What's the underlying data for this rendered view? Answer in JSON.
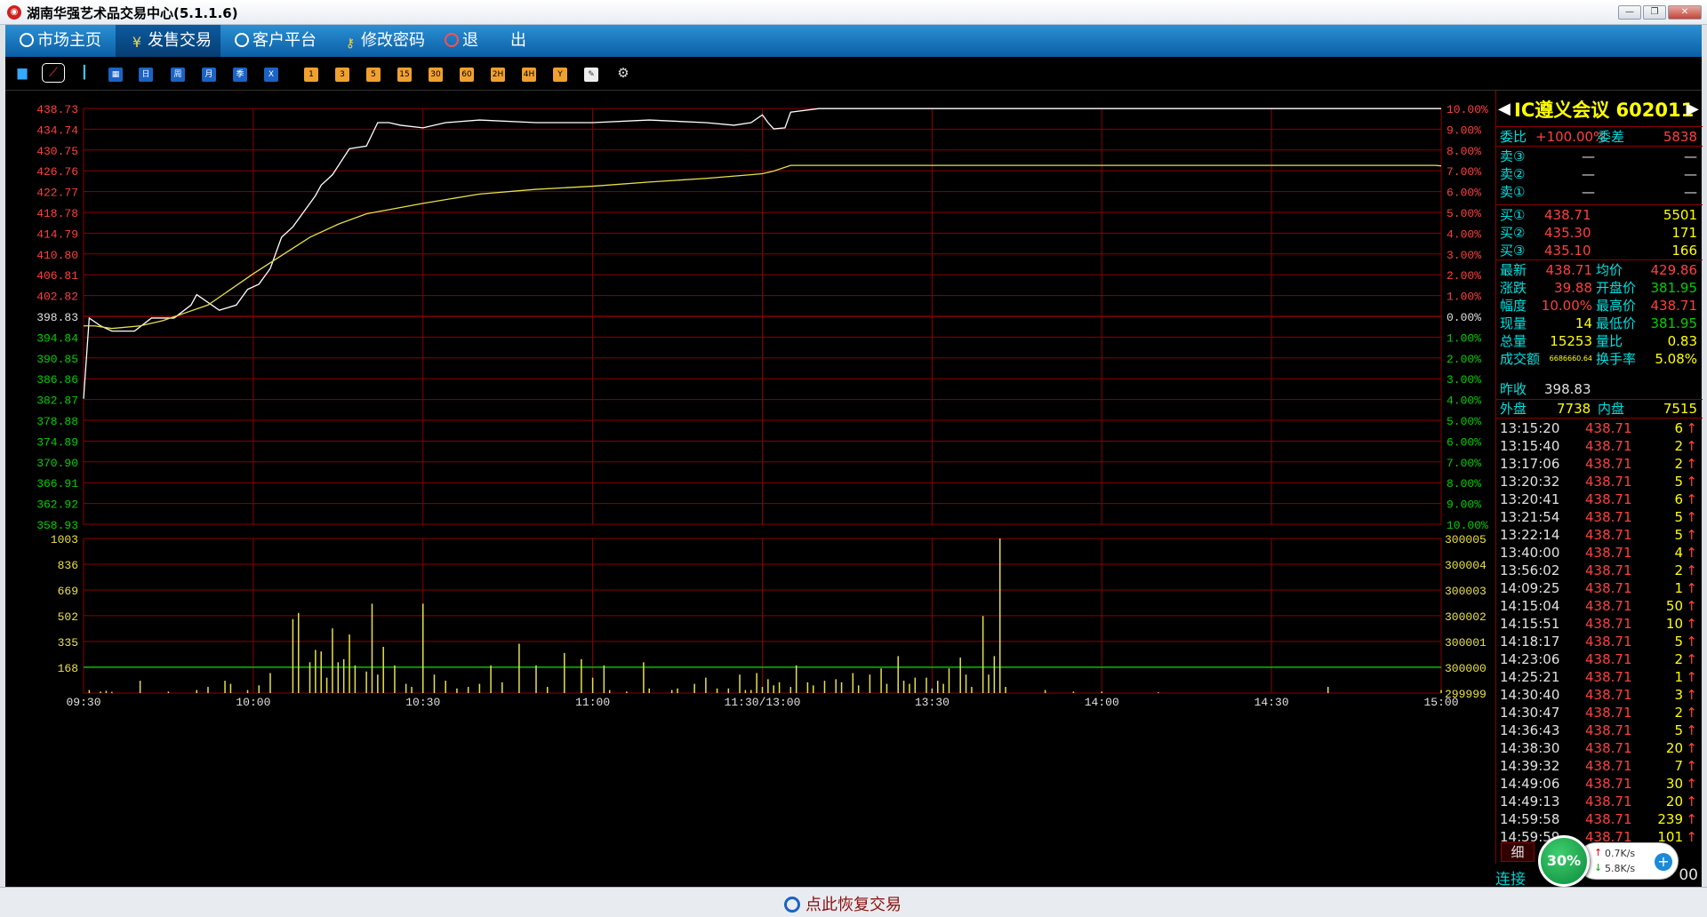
{
  "window": {
    "title": "湖南华强艺术品交易中心(5.1.1.6)"
  },
  "menu": {
    "items": [
      {
        "label": "市场主页"
      },
      {
        "label": "发售交易"
      },
      {
        "label": "客户平台"
      },
      {
        "label": "修改密码"
      },
      {
        "label": "退　　出"
      }
    ]
  },
  "toolbar": {
    "period_buttons": [
      "日",
      "周",
      "月",
      "季",
      "X"
    ],
    "minute_buttons": [
      "1",
      "3",
      "5",
      "15",
      "30",
      "60",
      "2H",
      "4H",
      "Y"
    ]
  },
  "chart_data": [
    {
      "type": "line",
      "title": "",
      "price_axis": [
        "438.73",
        "434.74",
        "430.75",
        "426.76",
        "422.77",
        "418.78",
        "414.79",
        "410.80",
        "406.81",
        "402.82",
        "398.83",
        "394.84",
        "390.85",
        "386.86",
        "382.87",
        "378.88",
        "374.89",
        "370.90",
        "366.91",
        "362.92",
        "358.93"
      ],
      "pct_axis": [
        "10.00%",
        "9.00%",
        "8.00%",
        "7.00%",
        "6.00%",
        "5.00%",
        "4.00%",
        "3.00%",
        "2.00%",
        "1.00%",
        "0.00%",
        "1.00%",
        "2.00%",
        "3.00%",
        "4.00%",
        "5.00%",
        "6.00%",
        "7.00%",
        "8.00%",
        "9.00%",
        "10.00%"
      ],
      "ylim": [
        358.93,
        438.73
      ],
      "x_ticks": [
        "09:30",
        "10:00",
        "10:30",
        "11:00",
        "11:30/13:00",
        "13:30",
        "14:00",
        "14:30",
        "15:00"
      ],
      "series": [
        {
          "name": "",
          "color": "#ffffff",
          "x": [
            0,
            1,
            3,
            5,
            9,
            12,
            16,
            19,
            20,
            24,
            27,
            29,
            31,
            33,
            35,
            37,
            39,
            41,
            42,
            44,
            47,
            50,
            52,
            54,
            56,
            60,
            64,
            70,
            80,
            90,
            100,
            110,
            115,
            118,
            120,
            121,
            122,
            124,
            125,
            130,
            135,
            140,
            145,
            150,
            160,
            170,
            180,
            190,
            200,
            210,
            220,
            230,
            235,
            239,
            240
          ],
          "y": [
            383.0,
            398.5,
            397.0,
            396.0,
            396.0,
            398.5,
            398.5,
            401.0,
            403.0,
            400.0,
            401.0,
            404.0,
            405.0,
            408.0,
            414.0,
            416.0,
            419.0,
            422.0,
            424.0,
            426.0,
            431.0,
            431.5,
            436.0,
            436.0,
            435.5,
            435.0,
            436.0,
            436.5,
            436.0,
            436.0,
            436.5,
            436.0,
            435.5,
            436.0,
            437.5,
            436.0,
            434.8,
            435.0,
            438.0,
            438.7,
            438.7,
            438.7,
            438.7,
            438.7,
            438.7,
            438.7,
            438.7,
            438.7,
            438.7,
            438.7,
            438.7,
            438.7,
            438.7,
            438.7,
            438.7
          ]
        },
        {
          "name": "",
          "color": "#e8e048",
          "x": [
            0,
            2,
            5,
            10,
            14,
            18,
            22,
            26,
            30,
            35,
            40,
            45,
            50,
            55,
            60,
            70,
            80,
            90,
            100,
            110,
            118,
            120,
            122,
            125,
            130,
            150,
            170,
            190,
            210,
            230,
            239,
            240
          ],
          "y": [
            397.0,
            397.0,
            396.5,
            397.0,
            398.0,
            399.5,
            401.0,
            404.0,
            407.0,
            410.5,
            414.0,
            416.5,
            418.5,
            419.5,
            420.5,
            422.3,
            423.2,
            423.8,
            424.6,
            425.3,
            426.0,
            426.2,
            426.7,
            427.8,
            427.8,
            427.8,
            427.8,
            427.8,
            427.8,
            427.8,
            427.8,
            427.7
          ]
        }
      ]
    },
    {
      "type": "bar",
      "title": "",
      "volume_axis_left": [
        "1003",
        "836",
        "669",
        "502",
        "335",
        "168"
      ],
      "volume_axis_right": [
        "300005",
        "300004",
        "300003",
        "300002",
        "300001",
        "300000",
        "299999"
      ],
      "ylim": [
        0,
        1003
      ],
      "reference_line": 168,
      "x": [
        1,
        3,
        4,
        5,
        10,
        15,
        20,
        22,
        25,
        26,
        29,
        31,
        33,
        37,
        38,
        40,
        41,
        42,
        43,
        44,
        45,
        46,
        47,
        48,
        50,
        51,
        52,
        53,
        55,
        57,
        58,
        60,
        62,
        64,
        66,
        68,
        70,
        72,
        74,
        77,
        80,
        82,
        85,
        88,
        90,
        92,
        93,
        96,
        99,
        100,
        104,
        105,
        108,
        110,
        112,
        114,
        116,
        117,
        118,
        119,
        120,
        121,
        122,
        123,
        125,
        126,
        128,
        129,
        131,
        133,
        134,
        136,
        137,
        139,
        141,
        142,
        144,
        145,
        146,
        147,
        149,
        150,
        151,
        152,
        153,
        155,
        156,
        157,
        159,
        160,
        161,
        162,
        163,
        170,
        175,
        180,
        190,
        220,
        240
      ],
      "y": [
        20,
        10,
        15,
        8,
        80,
        10,
        20,
        40,
        80,
        60,
        20,
        50,
        130,
        480,
        520,
        200,
        280,
        270,
        100,
        420,
        200,
        220,
        380,
        180,
        140,
        580,
        120,
        300,
        180,
        60,
        40,
        580,
        120,
        80,
        30,
        40,
        60,
        180,
        70,
        320,
        180,
        40,
        260,
        220,
        100,
        180,
        20,
        10,
        200,
        30,
        20,
        30,
        60,
        100,
        30,
        30,
        120,
        20,
        20,
        130,
        40,
        90,
        50,
        70,
        40,
        180,
        70,
        50,
        80,
        90,
        70,
        130,
        50,
        120,
        160,
        60,
        240,
        80,
        60,
        100,
        100,
        30,
        80,
        60,
        160,
        230,
        120,
        40,
        500,
        120,
        240,
        1003,
        40,
        20,
        10,
        10,
        5,
        40,
        20
      ]
    }
  ],
  "quote": {
    "name": "IC遵义会议",
    "code": "602011",
    "webi_label": "委比",
    "webi_value": "+100.00%",
    "weicha_label": "委差",
    "weicha_value": "5838",
    "asks": [
      {
        "label": "卖③",
        "price": "—",
        "vol": "—"
      },
      {
        "label": "卖②",
        "price": "—",
        "vol": "—"
      },
      {
        "label": "卖①",
        "price": "—",
        "vol": "—"
      }
    ],
    "bids": [
      {
        "label": "买①",
        "price": "438.71",
        "vol": "5501"
      },
      {
        "label": "买②",
        "price": "435.30",
        "vol": "171"
      },
      {
        "label": "买③",
        "price": "435.10",
        "vol": "166"
      }
    ],
    "stats": [
      {
        "l1": "最新",
        "v1": "438.71",
        "l2": "均价",
        "v2": "429.86",
        "c1": "red",
        "c2": "red"
      },
      {
        "l1": "涨跌",
        "v1": "39.88",
        "l2": "开盘价",
        "v2": "381.95",
        "c1": "red",
        "c2": "grn"
      },
      {
        "l1": "幅度",
        "v1": "10.00%",
        "l2": "最高价",
        "v2": "438.71",
        "c1": "red",
        "c2": "red"
      },
      {
        "l1": "现量",
        "v1": "14",
        "l2": "最低价",
        "v2": "381.95",
        "c1": "yel",
        "c2": "grn"
      },
      {
        "l1": "总量",
        "v1": "15253",
        "l2": "量比",
        "v2": "0.83",
        "c1": "yel",
        "c2": "yel"
      },
      {
        "l1": "成交额",
        "v1": "6686660.64",
        "l2": "换手率",
        "v2": "5.08%",
        "c1": "yel",
        "c2": "yel"
      }
    ],
    "prev_close_label": "昨收",
    "prev_close": "398.83",
    "outer_label": "外盘",
    "outer_value": "7738",
    "inner_label": "内盘",
    "inner_value": "7515",
    "ticks": [
      {
        "t": "13:15:20",
        "p": "438.71",
        "v": "6"
      },
      {
        "t": "13:15:40",
        "p": "438.71",
        "v": "2"
      },
      {
        "t": "13:17:06",
        "p": "438.71",
        "v": "2"
      },
      {
        "t": "13:20:32",
        "p": "438.71",
        "v": "5"
      },
      {
        "t": "13:20:41",
        "p": "438.71",
        "v": "6"
      },
      {
        "t": "13:21:54",
        "p": "438.71",
        "v": "5"
      },
      {
        "t": "13:22:14",
        "p": "438.71",
        "v": "5"
      },
      {
        "t": "13:40:00",
        "p": "438.71",
        "v": "4"
      },
      {
        "t": "13:56:02",
        "p": "438.71",
        "v": "2"
      },
      {
        "t": "14:09:25",
        "p": "438.71",
        "v": "1"
      },
      {
        "t": "14:15:04",
        "p": "438.71",
        "v": "50"
      },
      {
        "t": "14:15:51",
        "p": "438.71",
        "v": "10"
      },
      {
        "t": "14:18:17",
        "p": "438.71",
        "v": "5"
      },
      {
        "t": "14:23:06",
        "p": "438.71",
        "v": "2"
      },
      {
        "t": "14:25:21",
        "p": "438.71",
        "v": "1"
      },
      {
        "t": "14:30:40",
        "p": "438.71",
        "v": "3"
      },
      {
        "t": "14:30:47",
        "p": "438.71",
        "v": "2"
      },
      {
        "t": "14:36:43",
        "p": "438.71",
        "v": "5"
      },
      {
        "t": "14:38:30",
        "p": "438.71",
        "v": "20"
      },
      {
        "t": "14:39:32",
        "p": "438.71",
        "v": "7"
      },
      {
        "t": "14:49:06",
        "p": "438.71",
        "v": "30"
      },
      {
        "t": "14:49:13",
        "p": "438.71",
        "v": "20"
      },
      {
        "t": "14:59:58",
        "p": "438.71",
        "v": "239"
      },
      {
        "t": "14:59:59",
        "p": "438.71",
        "v": "101"
      }
    ],
    "detail_tab": "细"
  },
  "status": {
    "connection": "连接",
    "time": "00"
  },
  "network": {
    "percent": "30%",
    "up": "0.7K/s",
    "down": "5.8K/s"
  },
  "bottom": {
    "restore_label": "点此恢复交易"
  },
  "colors": {
    "grid": "#8b0000",
    "price_up": "#ff4040",
    "price_down": "#00d000",
    "accent": "#ffff00"
  }
}
